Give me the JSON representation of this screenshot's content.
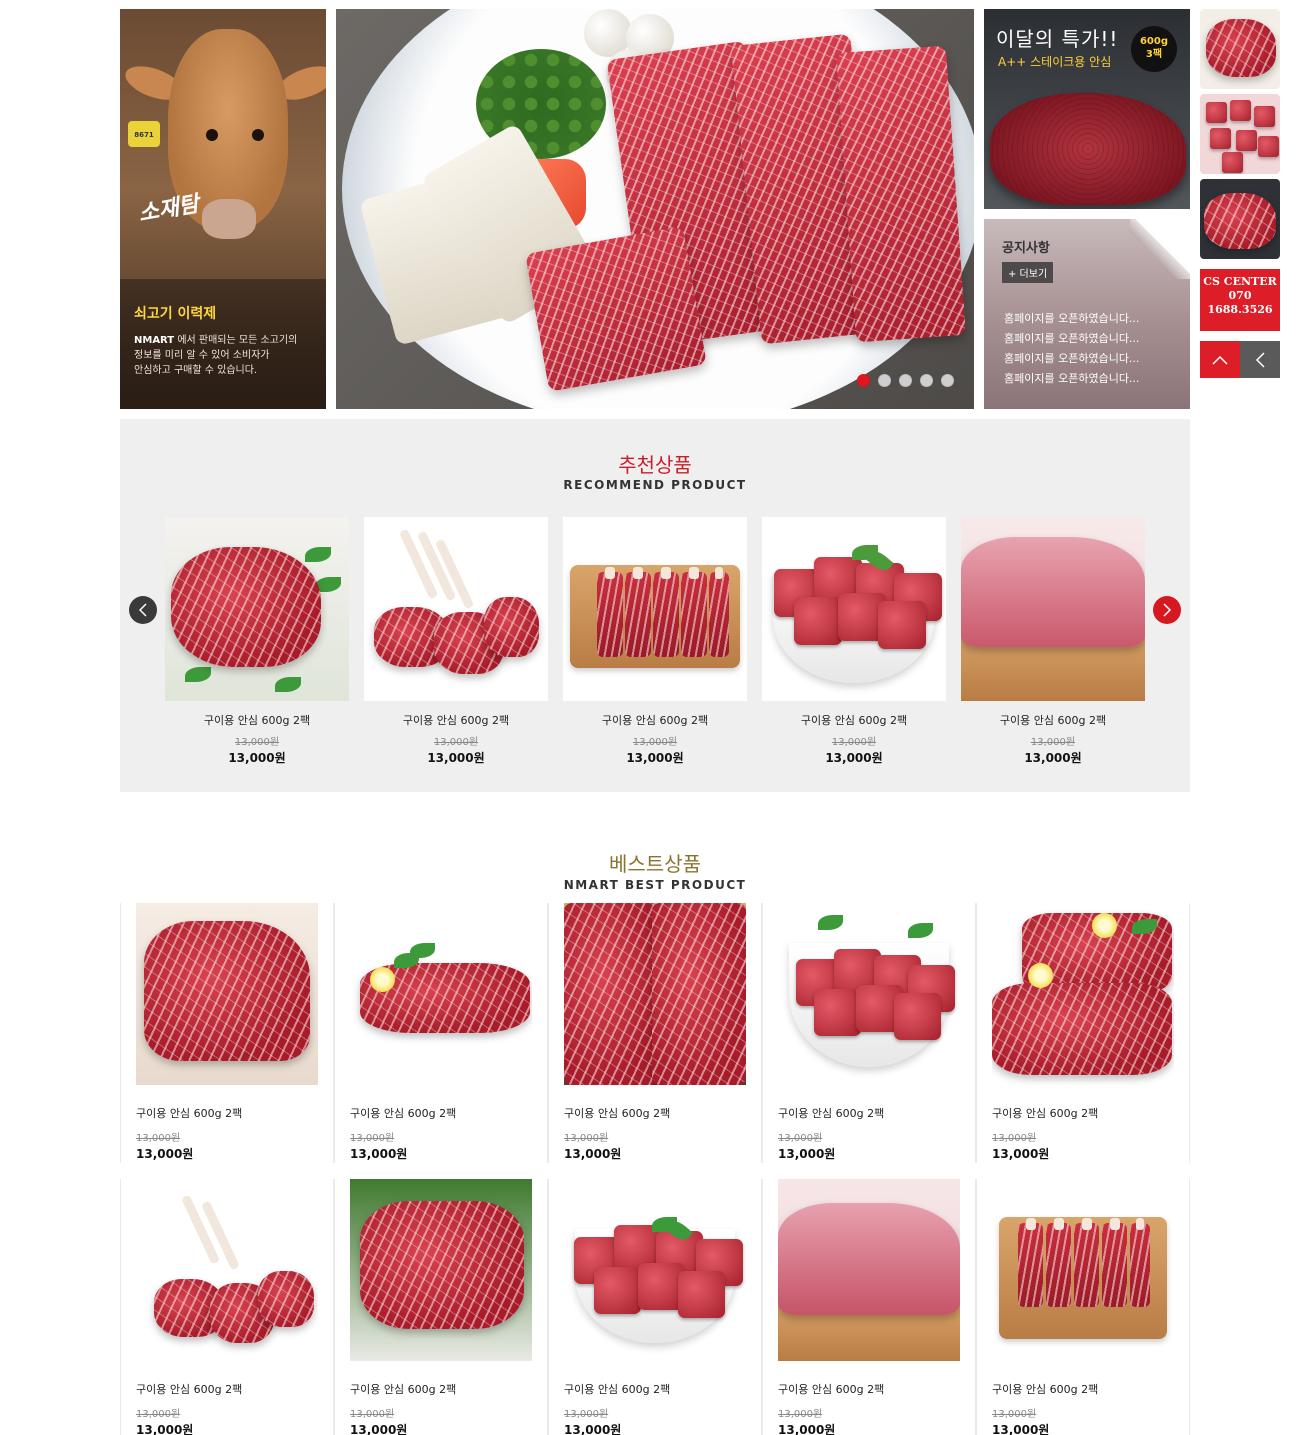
{
  "cow_panel": {
    "brush_text": "소재탐",
    "tag_text": "8671",
    "title": "쇠고기 이력제",
    "brand": "NMART",
    "desc_line1": "에서 판매되는 모든 소고기의",
    "desc_line2": "정보를 미리 알 수 있어 소비자가",
    "desc_line3": "안심하고 구매할 수 있습니다."
  },
  "hero": {
    "slides": 5,
    "active_slide": 1,
    "dot_labels": [
      "1",
      "2",
      "3",
      "4",
      "5"
    ]
  },
  "promo": {
    "title": "이달의 특가!!",
    "subtitle": "A++ 스테이크용 안심",
    "badge_line1": "600g",
    "badge_line2": "3팩"
  },
  "notice": {
    "title": "공지사항",
    "more_label": "+ 더보기",
    "items": [
      "홈페이지를 오픈하였습니다...",
      "홈페이지를 오픈하였습니다...",
      "홈페이지를 오픈하였습니다...",
      "홈페이지를 오픈하였습니다..."
    ]
  },
  "side": {
    "cs_title": "CS CENTER",
    "cs_line1": "070",
    "cs_line2": "1688.3526",
    "up_icon": "chevron-up-icon",
    "back_icon": "chevron-left-icon",
    "up_color": "#dd1d27",
    "back_color": "#5a5a5a"
  },
  "recommend": {
    "title_kr": "추천상품",
    "title_en": "RECOMMEND PRODUCT",
    "title_color": "#c8202a",
    "prev_icon": "chevron-left-icon",
    "next_icon": "chevron-right-icon",
    "items": [
      {
        "name": "구이용 안심 600g 2팩",
        "old_price": "13,000원",
        "price": "13,000원"
      },
      {
        "name": "구이용 안심 600g 2팩",
        "old_price": "13,000원",
        "price": "13,000원"
      },
      {
        "name": "구이용 안심 600g 2팩",
        "old_price": "13,000원",
        "price": "13,000원"
      },
      {
        "name": "구이용 안심 600g 2팩",
        "old_price": "13,000원",
        "price": "13,000원"
      },
      {
        "name": "구이용 안심 600g 2팩",
        "old_price": "13,000원",
        "price": "13,000원"
      }
    ]
  },
  "best": {
    "title_kr": "베스트상품",
    "title_en": "NMART BEST PRODUCT",
    "title_color": "#8a7330",
    "items": [
      {
        "name": "구이용 안심 600g 2팩",
        "old_price": "13,000원",
        "price": "13,000원"
      },
      {
        "name": "구이용 안심 600g 2팩",
        "old_price": "13,000원",
        "price": "13,000원"
      },
      {
        "name": "구이용 안심 600g 2팩",
        "old_price": "13,000원",
        "price": "13,000원"
      },
      {
        "name": "구이용 안심 600g 2팩",
        "old_price": "13,000원",
        "price": "13,000원"
      },
      {
        "name": "구이용 안심 600g 2팩",
        "old_price": "13,000원",
        "price": "13,000원"
      },
      {
        "name": "구이용 안심 600g 2팩",
        "old_price": "13,000원",
        "price": "13,000원"
      },
      {
        "name": "구이용 안심 600g 2팩",
        "old_price": "13,000원",
        "price": "13,000원"
      },
      {
        "name": "구이용 안심 600g 2팩",
        "old_price": "13,000원",
        "price": "13,000원"
      },
      {
        "name": "구이용 안심 600g 2팩",
        "old_price": "13,000원",
        "price": "13,000원"
      },
      {
        "name": "구이용 안심 600g 2팩",
        "old_price": "13,000원",
        "price": "13,000원"
      }
    ]
  }
}
